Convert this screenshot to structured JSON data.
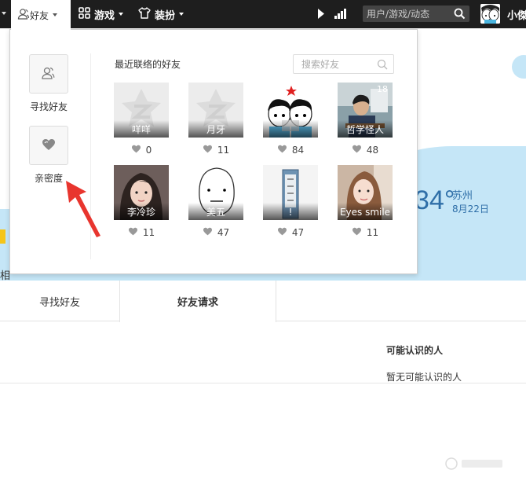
{
  "topbar": {
    "friends_label": "好友",
    "games_label": "游戏",
    "dressup_label": "装扮",
    "search_placeholder": "用户/游戏/动态",
    "username": "小傑"
  },
  "panel": {
    "side": [
      {
        "label": "寻找好友",
        "icon": "find-friends-icon"
      },
      {
        "label": "亲密度",
        "icon": "heart-icon"
      }
    ],
    "title": "最近联络的好友",
    "search_placeholder": "搜索好友",
    "friends": [
      {
        "name": "咩咩",
        "intimacy": "0",
        "avatar": "default-qq"
      },
      {
        "name": "月牙",
        "intimacy": "11",
        "avatar": "default-qq"
      },
      {
        "name": "",
        "intimacy": "84",
        "avatar": "cartoon-couple"
      },
      {
        "name": "哲学怪人",
        "intimacy": "48",
        "avatar": "photo-boy",
        "badge": "18"
      },
      {
        "name": "李冷珍",
        "intimacy": "11",
        "avatar": "photo-girl"
      },
      {
        "name": "美五",
        "intimacy": "47",
        "avatar": "meme-face"
      },
      {
        "name": "!",
        "intimacy": "47",
        "avatar": "book"
      },
      {
        "name": "Eyes smile",
        "intimacy": "11",
        "avatar": "photo-girl2"
      }
    ]
  },
  "background": {
    "weather_temp": "34°",
    "weather_city": "苏州",
    "weather_date": "8月22日",
    "left_char": "相"
  },
  "tabs": [
    {
      "label": "寻找好友"
    },
    {
      "label": "好友请求"
    }
  ],
  "may_know": {
    "title": "可能认识的人",
    "empty": "暂无可能认识的人"
  },
  "colors": {
    "topbar": "#1e1e1e",
    "sky": "#c5e6f7",
    "weather_text": "#2f6fa8",
    "arrow": "#e8352e"
  }
}
